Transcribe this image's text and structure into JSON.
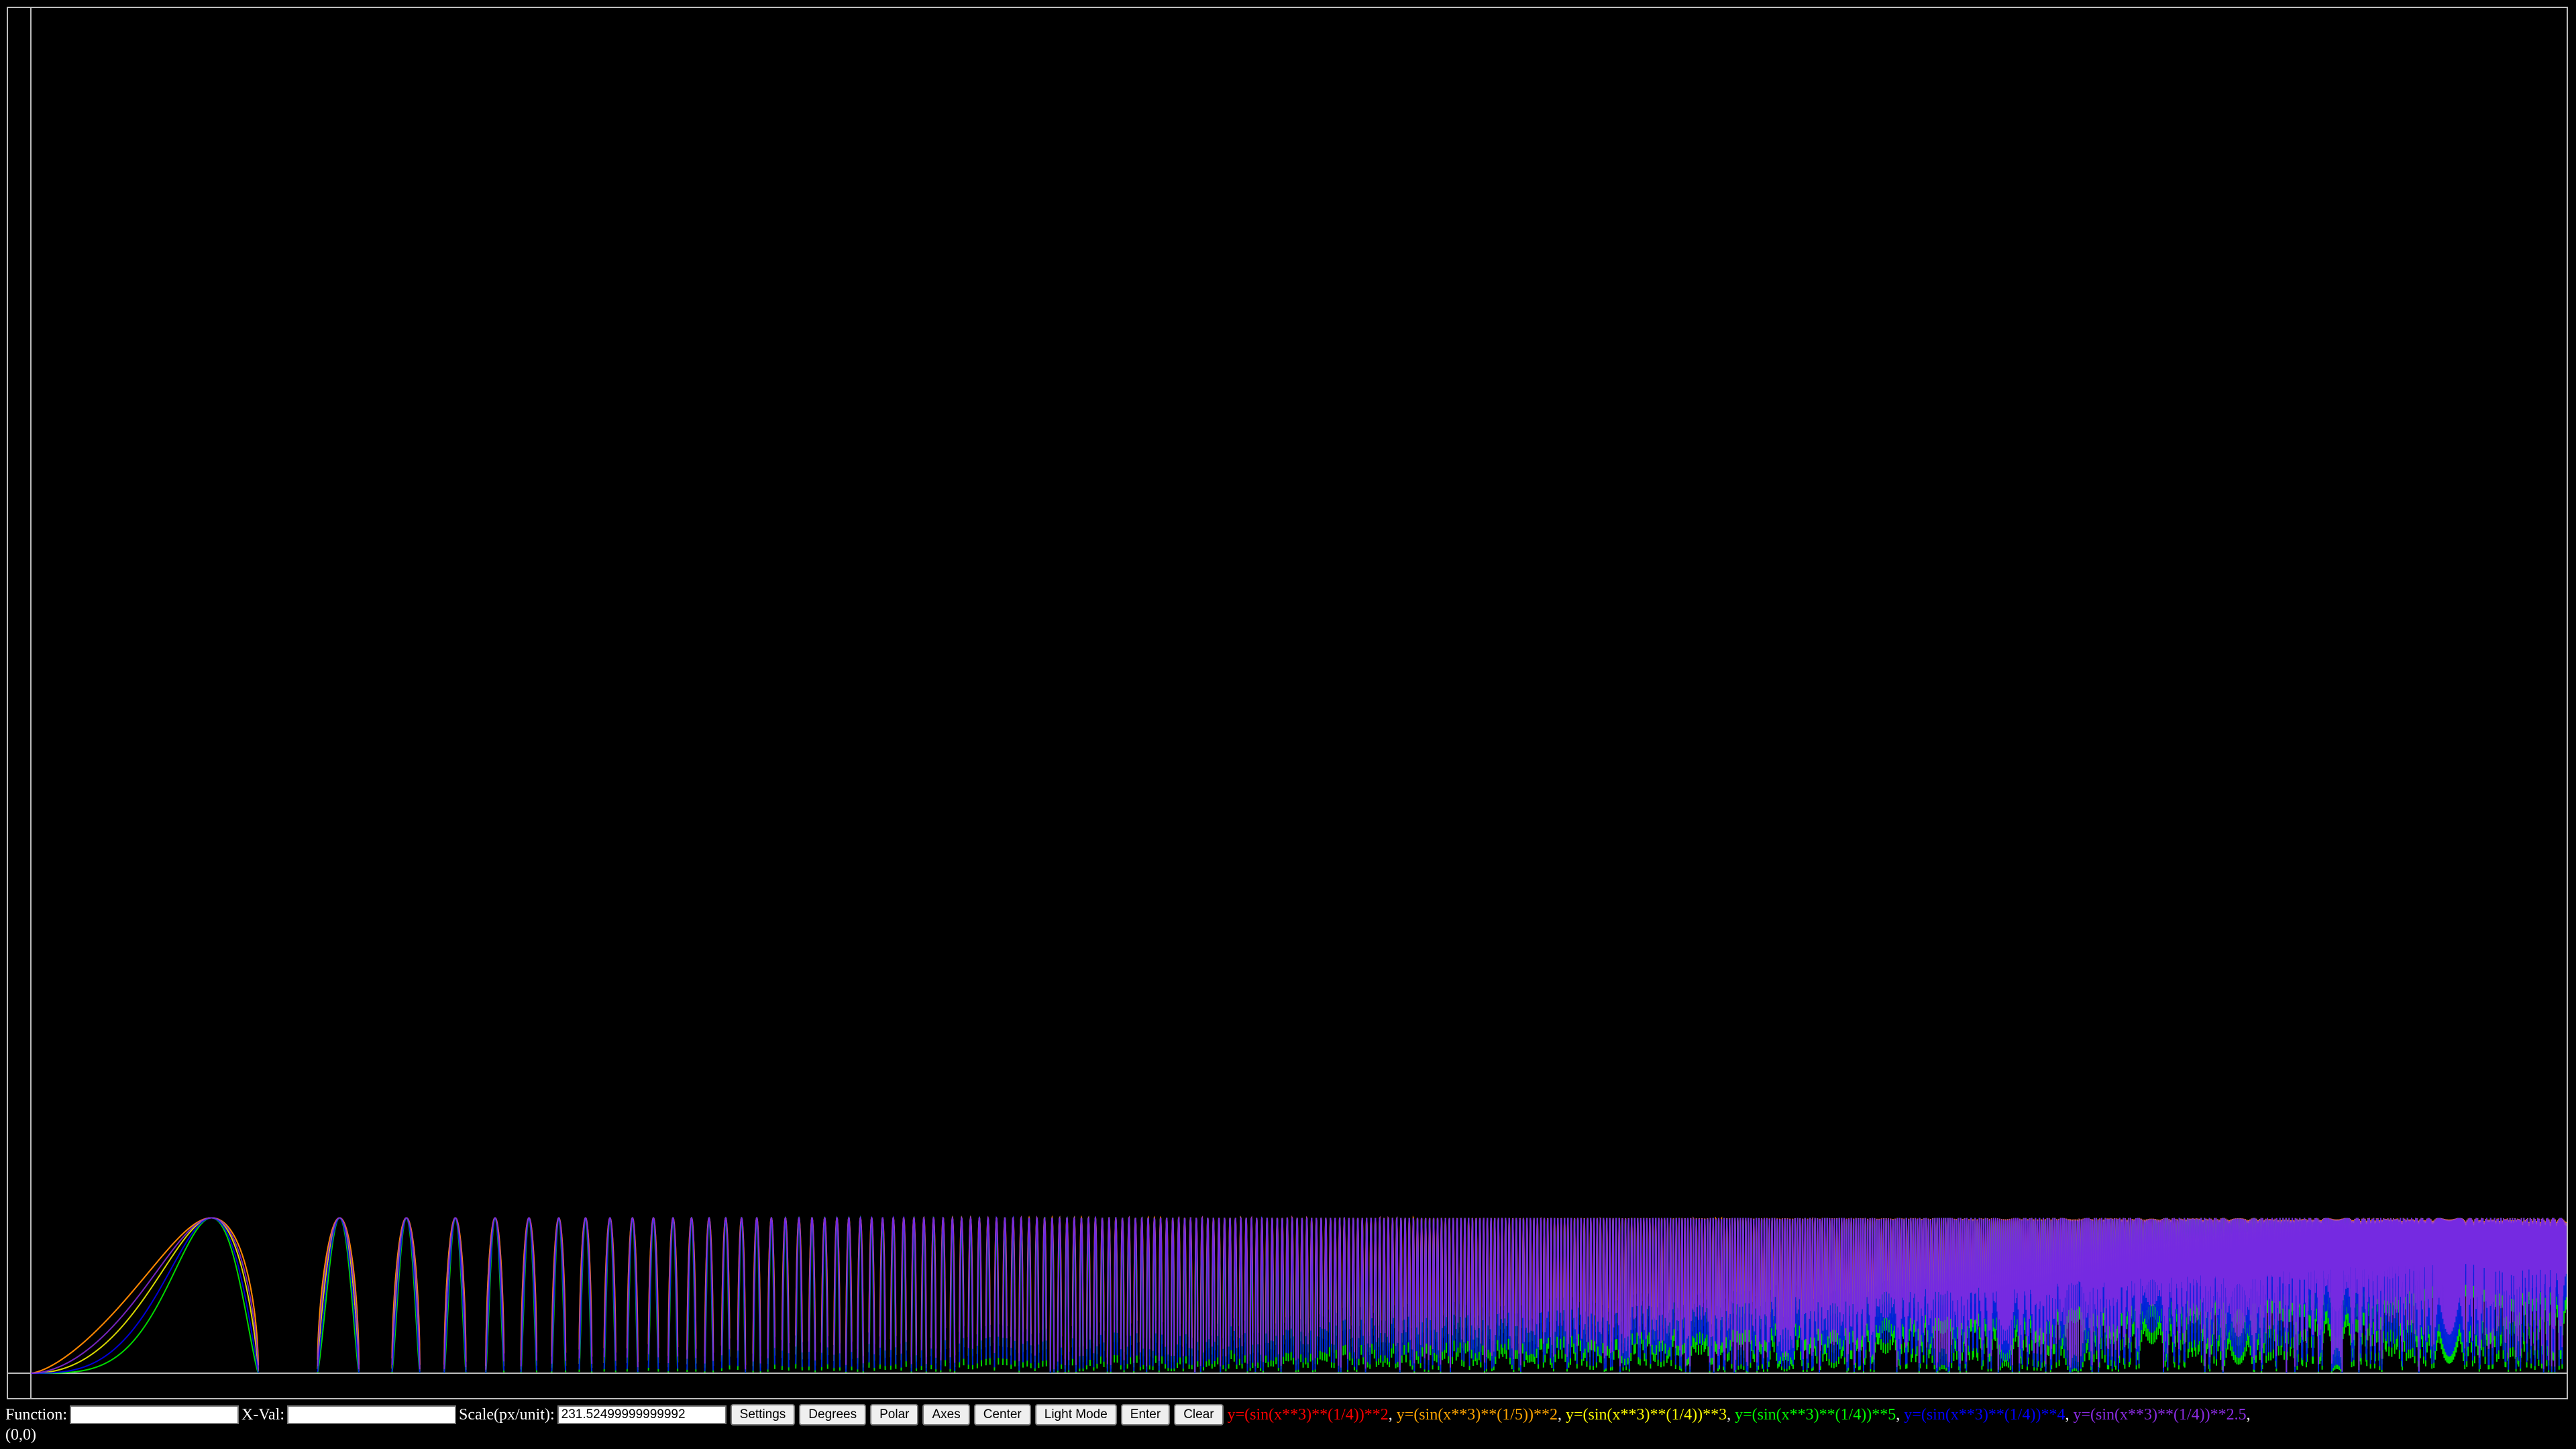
{
  "toolbar": {
    "function_label": "Function:",
    "function_value": "",
    "xval_label": "X-Val:",
    "xval_value": "",
    "scale_label": "Scale(px/unit):",
    "scale_value": "231.52499999999992",
    "buttons": [
      "Settings",
      "Degrees",
      "Polar",
      "Axes",
      "Center",
      "Light Mode",
      "Enter",
      "Clear"
    ]
  },
  "functions": [
    {
      "text": "y=(sin(x**3)**(1/4))**2",
      "color": "#ff0000",
      "exponent": 2
    },
    {
      "text": "y=(sin(x**3)**(1/5))**2",
      "color": "#ffa500",
      "exponent": 2
    },
    {
      "text": "y=(sin(x**3)**(1/4))**3",
      "color": "#ffff00",
      "exponent": 3
    },
    {
      "text": "y=(sin(x**3)**(1/4))**5",
      "color": "#00ff00",
      "exponent": 5
    },
    {
      "text": "y=(sin(x**3)**(1/4))**4",
      "color": "#0000ff",
      "exponent": 4
    },
    {
      "text": "y=(sin(x**3)**(1/4))**2.5",
      "color": "#8a2be2",
      "exponent": 2.5
    }
  ],
  "coordinate_readout": "(0,0)"
}
